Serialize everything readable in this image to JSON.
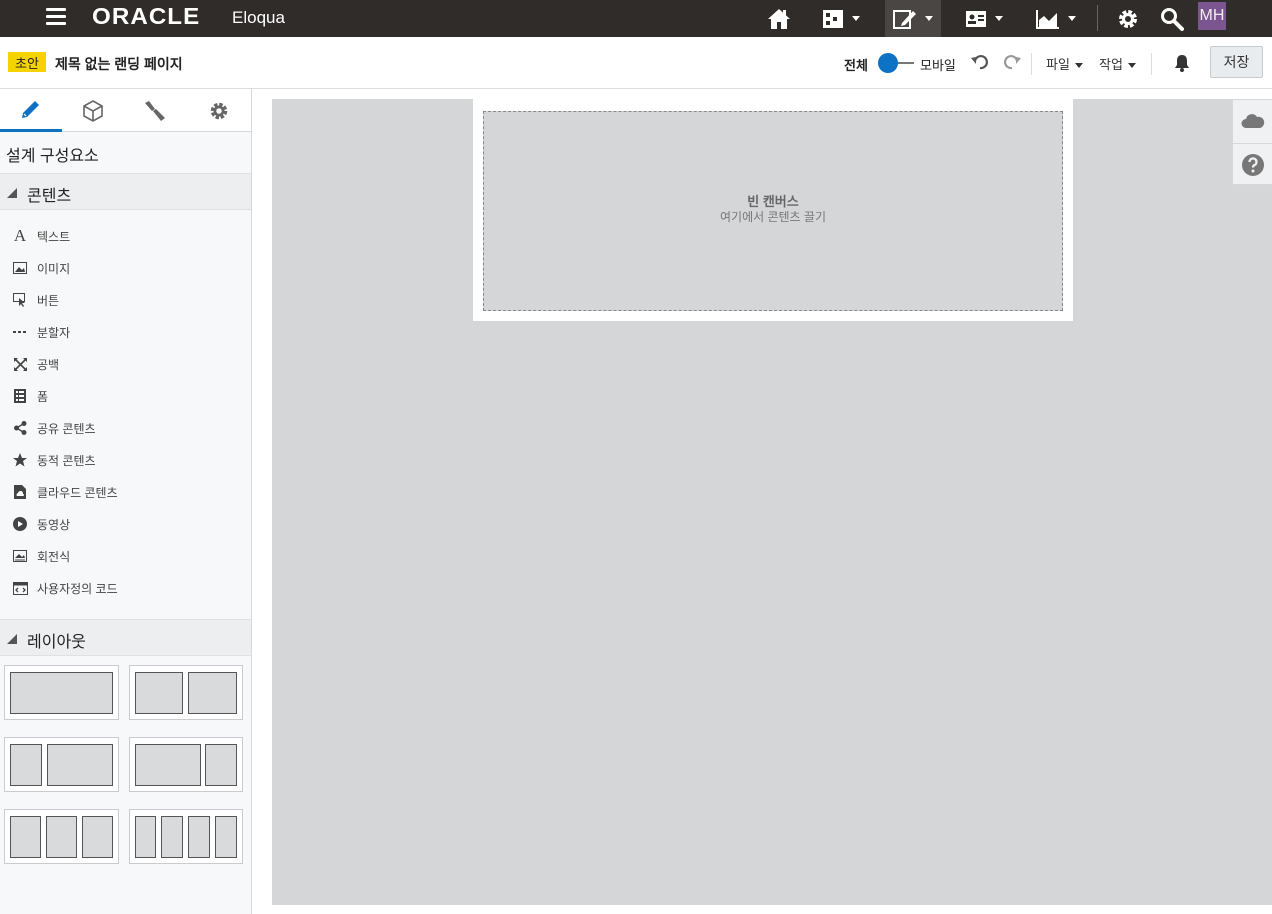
{
  "topbar": {
    "brand": "ORACLE",
    "product": "Eloqua",
    "avatar": "MH",
    "nav_icons": [
      "home-icon",
      "campaign-icon",
      "assets-edit-icon",
      "contacts-icon",
      "insight-chart-icon",
      "settings-gear-icon",
      "search-icon"
    ]
  },
  "subbar": {
    "status_badge": "초안",
    "page_title": "제목 없는 랜딩 페이지",
    "view_full": "전체",
    "view_mobile": "모바일",
    "file_menu": "파일",
    "actions_menu": "작업",
    "save": "저장"
  },
  "sidebar": {
    "heading": "설계 구성요소",
    "tabs": [
      "pencil-icon",
      "cube-icon",
      "brush-icon",
      "gear-icon"
    ],
    "content_section": "콘텐츠",
    "items": [
      {
        "label": "텍스트",
        "icon": "text-icon"
      },
      {
        "label": "이미지",
        "icon": "image-icon"
      },
      {
        "label": "버튼",
        "icon": "button-icon"
      },
      {
        "label": "분할자",
        "icon": "divider-icon"
      },
      {
        "label": "공백",
        "icon": "spacer-icon"
      },
      {
        "label": "폼",
        "icon": "form-icon"
      },
      {
        "label": "공유 콘텐츠",
        "icon": "share-icon"
      },
      {
        "label": "동적 콘텐츠",
        "icon": "star-icon"
      },
      {
        "label": "클라우드 콘텐츠",
        "icon": "cloud-file-icon"
      },
      {
        "label": "동영상",
        "icon": "video-icon"
      },
      {
        "label": "회전식",
        "icon": "carousel-icon"
      },
      {
        "label": "사용자정의 코드",
        "icon": "code-icon"
      }
    ],
    "layout_section": "레이아웃"
  },
  "canvas": {
    "empty_title": "빈 캔버스",
    "empty_hint": "여기에서 콘텐츠 끌기"
  },
  "colors": {
    "topbar": "#302c2a",
    "accent": "#0d72c4",
    "draft": "#f5d300",
    "avatar": "#7a5590"
  }
}
